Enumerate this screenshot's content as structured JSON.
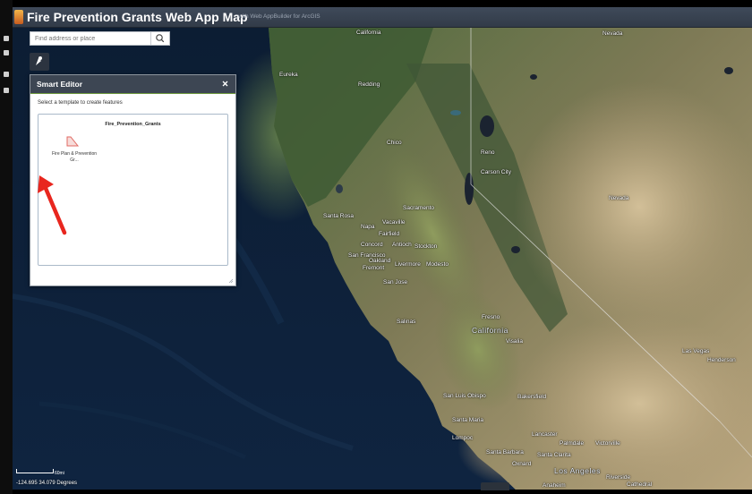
{
  "header": {
    "title": "Fire Prevention Grants Web App Map",
    "subtitle": "with Web AppBuilder for ArcGIS"
  },
  "search": {
    "placeholder": "Find address or place"
  },
  "smart_editor": {
    "title": "Smart Editor",
    "instruction": "Select a template to create features",
    "layer_name": "Fire_Prevention_Grants",
    "template_label_line1": "Fire Plan & Prevention",
    "template_label_line2": "Gr..."
  },
  "map": {
    "labels": {
      "california_top": "California",
      "nevada_top": "Nevada",
      "eureka": "Eureka",
      "redding": "Redding",
      "chico": "Chico",
      "reno": "Reno",
      "carson_city": "Carson City",
      "nevada": "Nevada",
      "sacramento": "Sacramento",
      "santa_rosa": "Santa Rosa",
      "vacaville": "Vacaville",
      "napa": "Napa",
      "fairfield": "Fairfield",
      "concord": "Concord",
      "antioch": "Antioch",
      "stockton": "Stockton",
      "san_francisco": "San Francisco",
      "oakland": "Oakland",
      "livermore": "Livermore",
      "modesto": "Modesto",
      "fremont": "Fremont",
      "san_jose": "San Jose",
      "fresno": "Fresno",
      "california": "California",
      "salinas": "Salinas",
      "visalia": "Visalia",
      "las_vegas": "Las Vegas",
      "henderson": "Henderson",
      "san_luis_obispo": "San Luis Obispo",
      "bakersfield": "Bakersfield",
      "santa_maria": "Santa Maria",
      "lompoc": "Lompoc",
      "lancaster": "Lancaster",
      "palmdale": "Palmdale",
      "victorville": "Victorville",
      "santa_barbara": "Santa Barbara",
      "santa_clarita": "Santa Clarita",
      "oxnard": "Oxnard",
      "los_angeles": "Los Angeles",
      "riverside": "Riverside",
      "anaheim": "Anaheim",
      "cathedral": "Cathedral"
    },
    "scale_label": "60mi",
    "coordinates": "-124.695 34.079 Degrees"
  },
  "colors": {
    "header_bg": "#3a4452",
    "panel_header_bg": "#3d4653",
    "accent_green": "#6f9a3e",
    "annotation_arrow": "#e8261e",
    "template_icon": "#e06a63"
  },
  "icons": [
    "search-icon",
    "locate-icon",
    "close-icon",
    "polygon-template-icon",
    "annotation-arrow",
    "resize-grip-icon",
    "app-logo"
  ]
}
